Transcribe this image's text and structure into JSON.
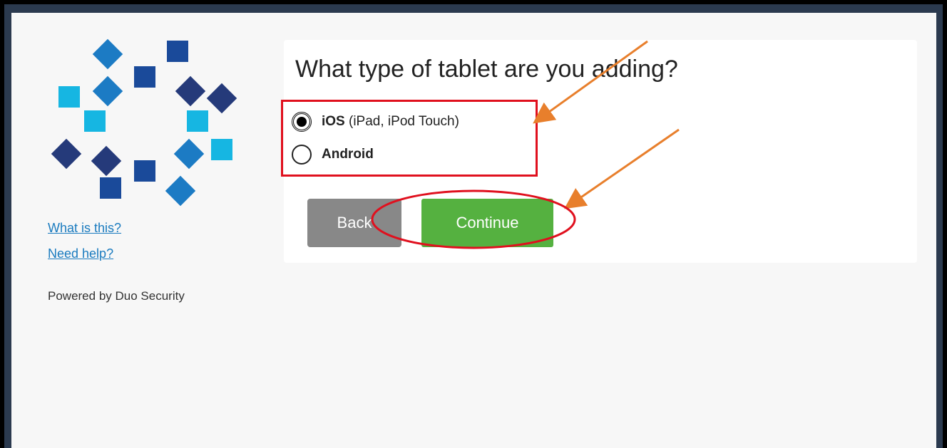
{
  "sidebar": {
    "what_is_this": "What is this?",
    "need_help": "Need help?",
    "powered_by": "Powered by Duo Security"
  },
  "card": {
    "question": "What type of tablet are you adding?",
    "options": [
      {
        "bold": "iOS",
        "detail": " (iPad, iPod Touch)",
        "selected": true
      },
      {
        "bold": "Android",
        "detail": "",
        "selected": false
      }
    ],
    "back_label": "Back",
    "continue_label": "Continue"
  },
  "colors": {
    "logo_dark": "#253a7a",
    "logo_mid": "#1a5aa6",
    "logo_blue": "#1c7bc4",
    "logo_cyan": "#16b6e2",
    "continue_green": "#55b140",
    "back_gray": "#888888",
    "annotation_red": "#e0101e",
    "annotation_orange": "#e87f2c"
  }
}
